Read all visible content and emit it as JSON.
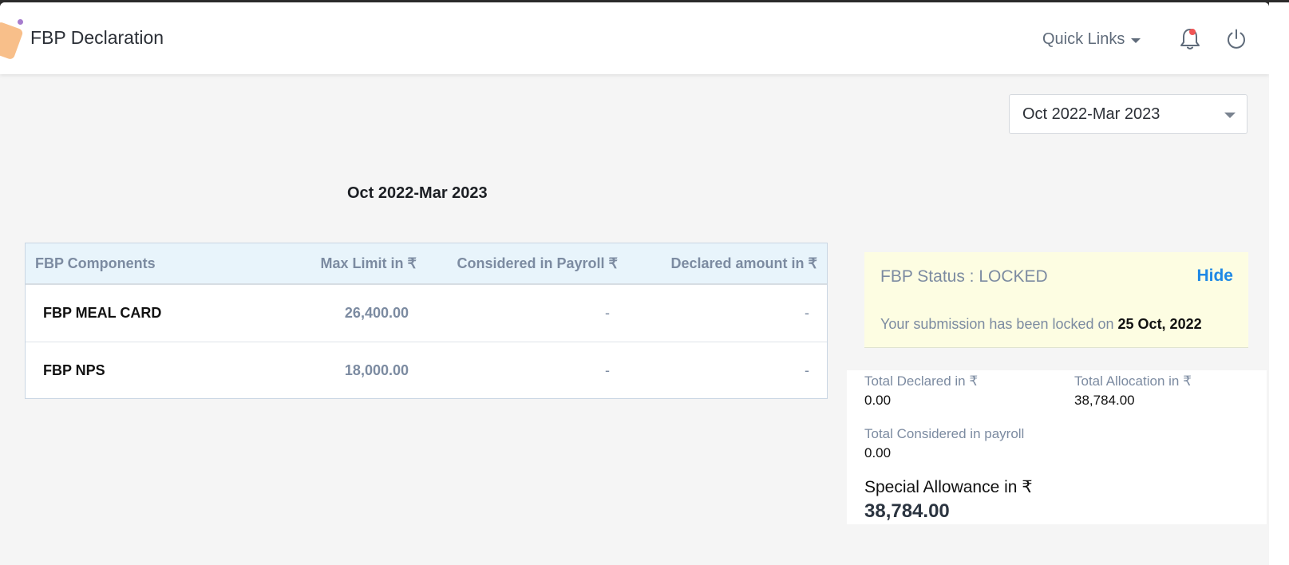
{
  "header": {
    "title": "FBP Declaration",
    "quick_links_label": "Quick Links",
    "icons": [
      "bell-icon",
      "power-icon"
    ],
    "notification_color": "#f05454"
  },
  "period_select": {
    "selected": "Oct 2022-Mar 2023"
  },
  "section_title": "Oct 2022-Mar 2023",
  "table": {
    "headers": {
      "component": "FBP Components",
      "max_limit": "Max Limit in ₹",
      "considered": "Considered in Payroll ₹",
      "declared": "Declared amount in ₹"
    },
    "rows": [
      {
        "component": "FBP MEAL CARD",
        "max_limit": "26,400.00",
        "considered": "-",
        "declared": "-"
      },
      {
        "component": "FBP NPS",
        "max_limit": "18,000.00",
        "considered": "-",
        "declared": "-"
      }
    ]
  },
  "status": {
    "label": "FBP Status : LOCKED",
    "hide_label": "Hide",
    "message": "Your submission has been locked on ",
    "locked_date": "25 Oct, 2022"
  },
  "totals": {
    "declared_label": "Total Declared in ₹",
    "declared_value": "0.00",
    "allocation_label": "Total Allocation in ₹",
    "allocation_value": "38,784.00",
    "considered_label": "Total Considered in payroll",
    "considered_value": "0.00",
    "special_label": "Special Allowance in ₹",
    "special_value": "38,784.00"
  },
  "colors": {
    "accent": "#1e88e5",
    "table_header_bg": "#e8f4fb",
    "status_bg": "#fdfde2"
  }
}
